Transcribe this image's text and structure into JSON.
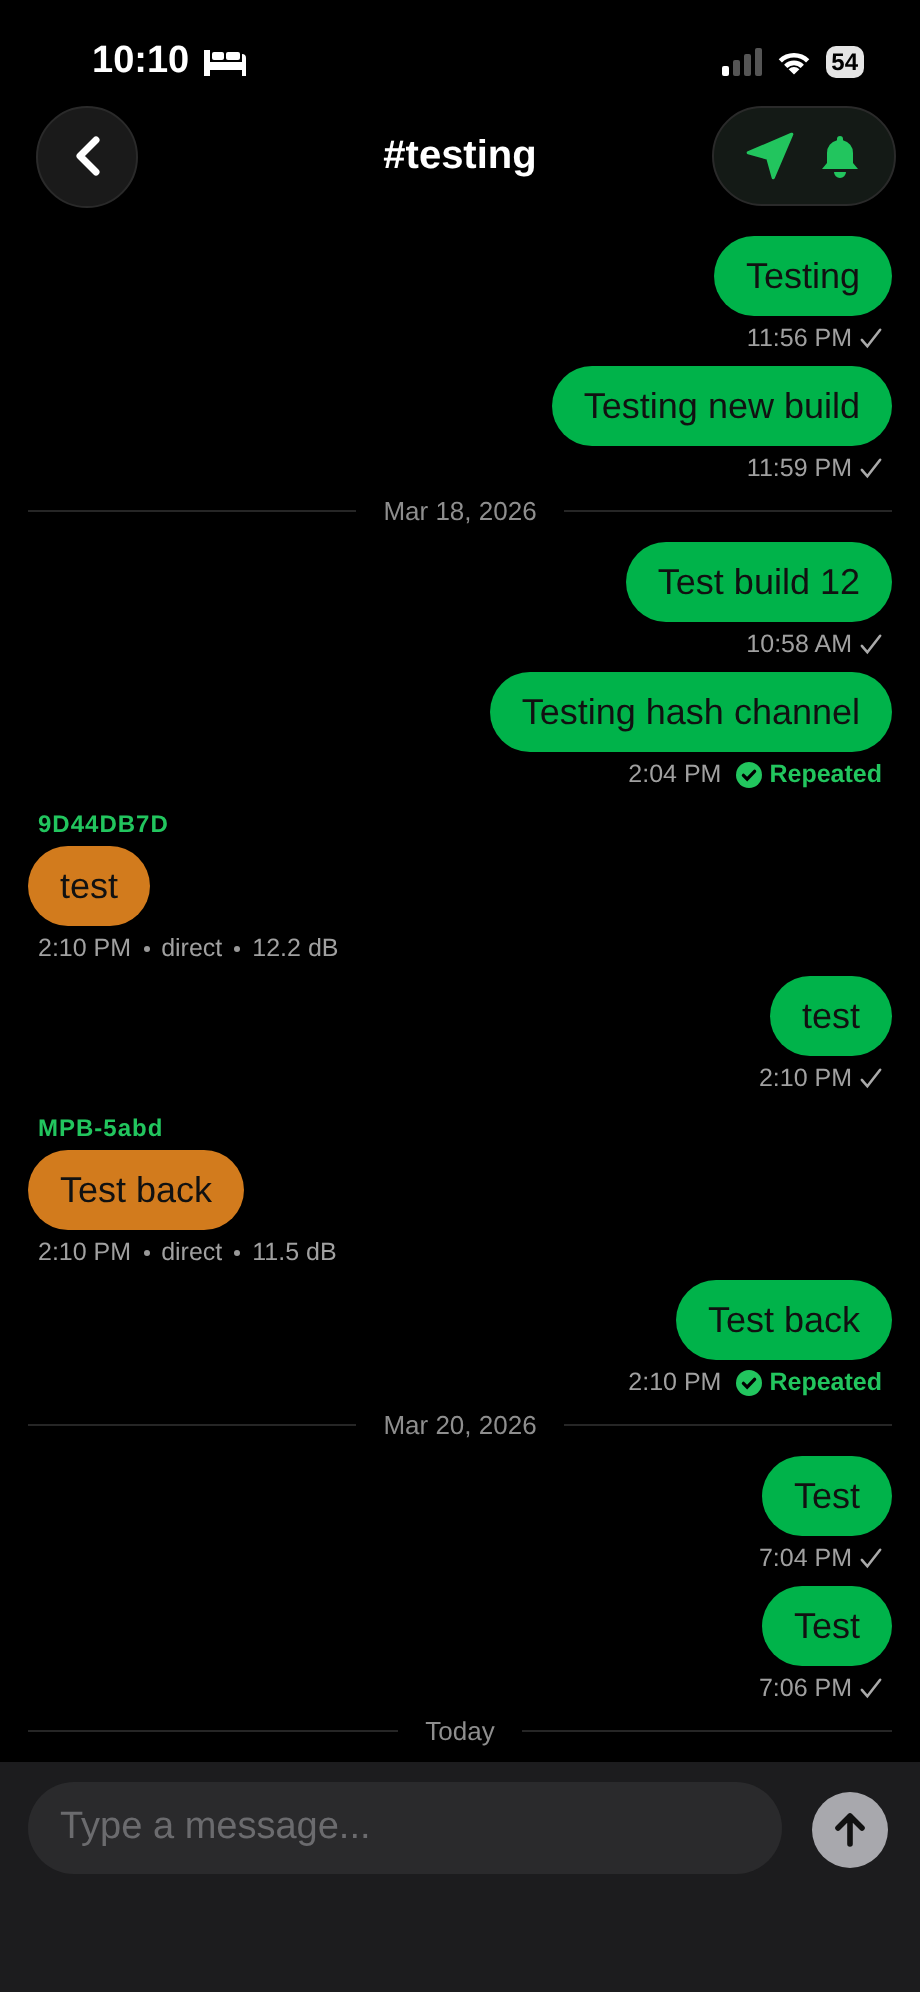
{
  "status_bar": {
    "time": "10:10",
    "battery": "54"
  },
  "header": {
    "title": "#testing"
  },
  "messages": [
    {
      "kind": "sent",
      "text": "Testing",
      "time": "11:56 PM",
      "repeated": false
    },
    {
      "kind": "sent",
      "text": "Testing new build",
      "time": "11:59 PM",
      "repeated": false
    },
    {
      "kind": "date",
      "text": "Mar 18, 2026"
    },
    {
      "kind": "sent",
      "text": "Test build 12",
      "time": "10:58 AM",
      "repeated": false
    },
    {
      "kind": "sent",
      "text": "Testing hash channel",
      "time": "2:04 PM",
      "repeated": true,
      "status_label": "Repeated"
    },
    {
      "kind": "received",
      "sender": "9D44DB7D",
      "text": "test",
      "time": "2:10 PM",
      "route": "direct",
      "snr": "12.2 dB"
    },
    {
      "kind": "sent",
      "text": "test",
      "time": "2:10 PM",
      "repeated": false
    },
    {
      "kind": "received",
      "sender": "MPB-5abd",
      "text": "Test back",
      "time": "2:10 PM",
      "route": "direct",
      "snr": "11.5 dB"
    },
    {
      "kind": "sent",
      "text": "Test back",
      "time": "2:10 PM",
      "repeated": true,
      "status_label": "Repeated"
    },
    {
      "kind": "date",
      "text": "Mar 20, 2026"
    },
    {
      "kind": "sent",
      "text": "Test",
      "time": "7:04 PM",
      "repeated": false
    },
    {
      "kind": "sent",
      "text": "Test",
      "time": "7:06 PM",
      "repeated": false
    },
    {
      "kind": "date",
      "text": "Today"
    }
  ],
  "composer": {
    "placeholder": "Type a message..."
  }
}
